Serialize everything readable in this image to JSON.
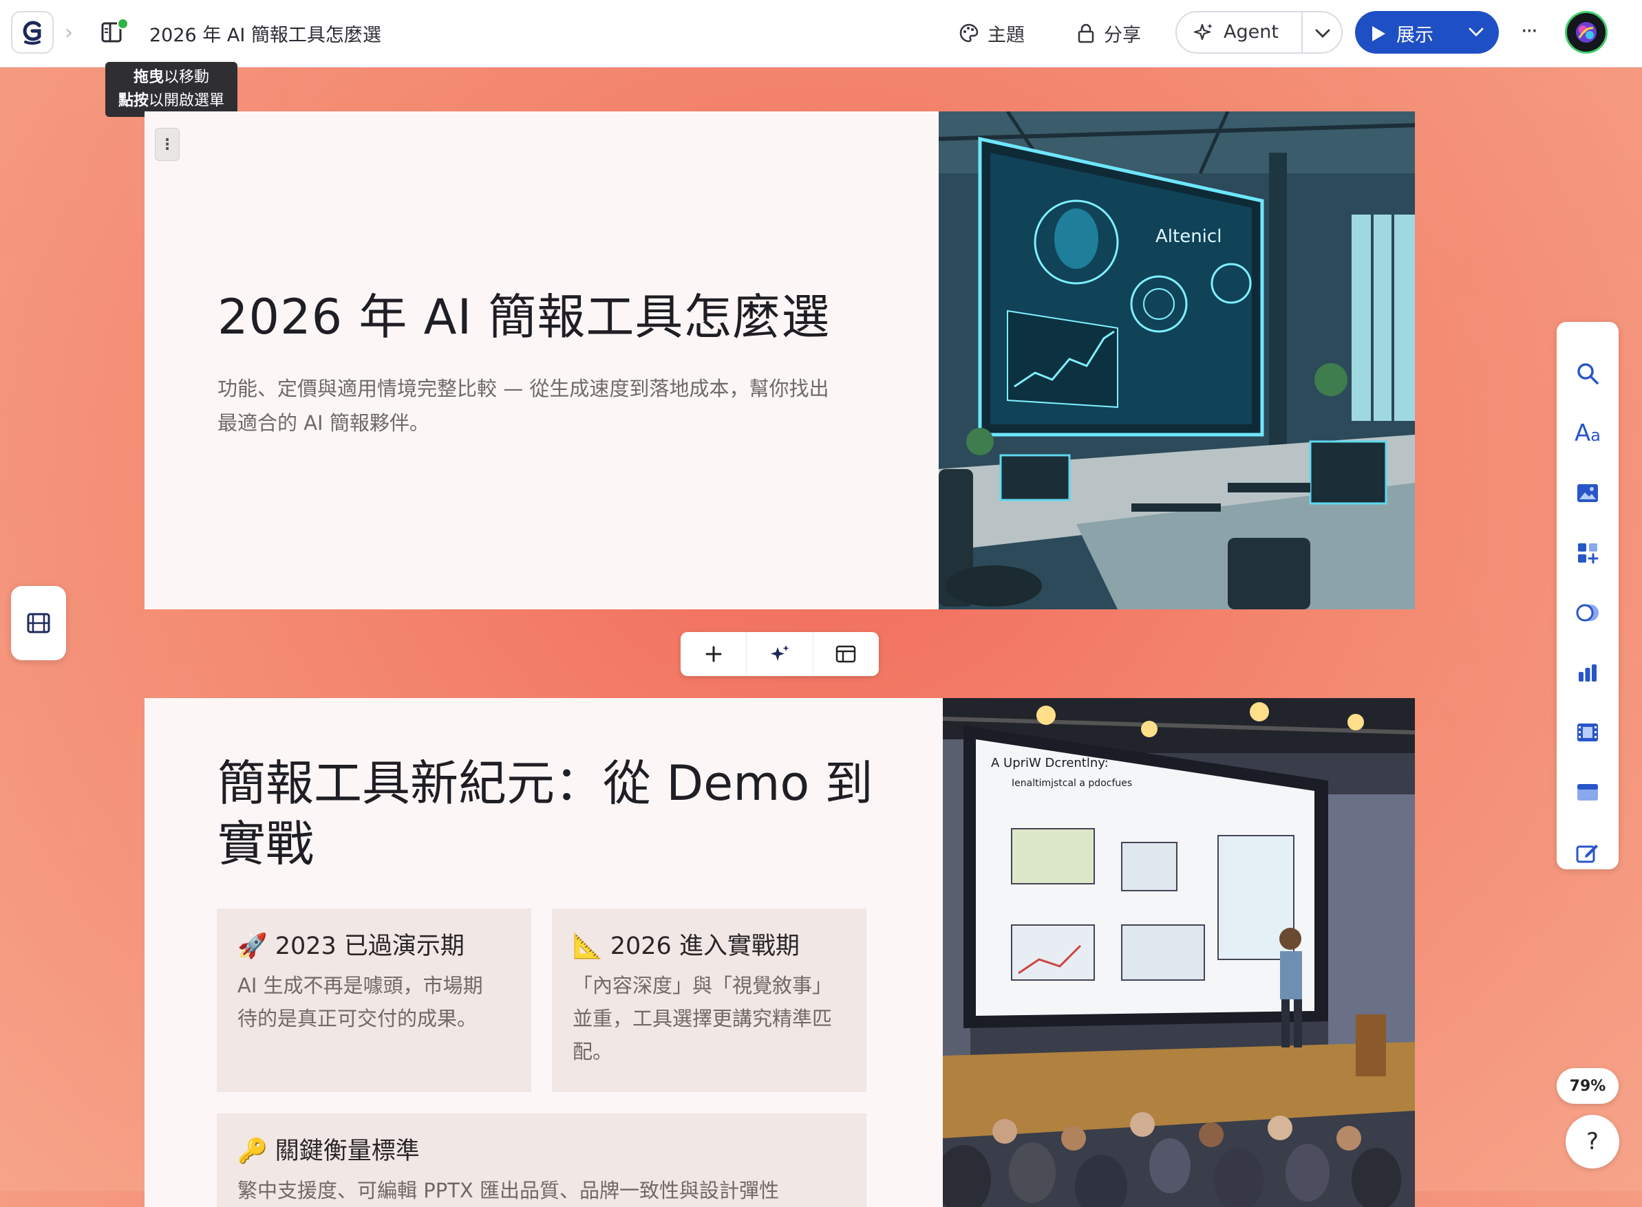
{
  "app": {
    "logo_letter": "G"
  },
  "header": {
    "doc_title": "2026 年 AI 簡報工具怎麼選",
    "theme_label": "主題",
    "share_label": "分享",
    "agent_label": "Agent",
    "present_label": "展示",
    "more_label": "···"
  },
  "tooltip": {
    "line1_bold": "拖曳",
    "line1_rest": "以移動",
    "line2_bold": "點按",
    "line2_rest": "以開啟選單"
  },
  "card1": {
    "title": "2026 年 AI 簡報工具怎麼選",
    "subtitle_line1": "功能、定價與適用情境完整比較 — 從生成速度到落地成本，幫你找出",
    "subtitle_line2": "最適合的 AI 簡報夥伴。",
    "image_screen_text": "Altenicl"
  },
  "card2": {
    "title_line1": "簡報工具新紀元：從 Demo 到",
    "title_line2": "實戰",
    "boxes": [
      {
        "title": "🚀 2023 已過演示期",
        "body_line1": "AI 生成不再是噱頭，市場期",
        "body_line2": "待的是真正可交付的成果。",
        "body_line3": ""
      },
      {
        "title": "📐 2026 進入實戰期",
        "body_line1": "「內容深度」與「視覺敘事」",
        "body_line2": "並重，工具選擇更講究精準匹",
        "body_line3": "配。"
      },
      {
        "title": "🔑 關鍵衡量標準",
        "body_line1": "繁中支援度、可編輯 PPTX 匯出品質、品牌一致性與設計彈性",
        "body_line2": "",
        "body_line3": ""
      }
    ],
    "image_screen_title": "A UpriW Dcrentlny:",
    "image_screen_sub": "Ienaltimjstcal a pdocfues"
  },
  "zoom": {
    "level": "79%"
  },
  "help": {
    "label": "?"
  },
  "colors": {
    "accent": "#1f4fc4",
    "present_bg": "#1f4fc4",
    "card_bg": "#fcf7f6",
    "mini_card_bg": "#f1e7e5",
    "page_bg": "#f3876f"
  }
}
